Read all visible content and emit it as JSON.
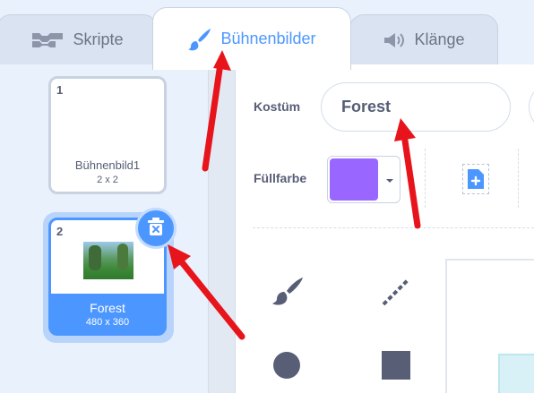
{
  "tabs": {
    "code_label": "Skripte",
    "costumes_label": "Bühnenbilder",
    "sounds_label": "Klänge"
  },
  "backdrops": [
    {
      "number": "1",
      "name": "Bühnenbild1",
      "size": "2 x 2"
    },
    {
      "number": "2",
      "name": "Forest",
      "size": "480 x 360"
    }
  ],
  "editor": {
    "costume_label": "Kostüm",
    "costume_name": "Forest",
    "fill_label": "Füllfarbe",
    "fill_color": "#9966ff"
  },
  "colors": {
    "accent": "#4c97ff",
    "arrow": "#e8141b"
  },
  "icons": {
    "code_tab": "code-blocks-icon",
    "costumes_tab": "paintbrush-icon",
    "sounds_tab": "speaker-icon",
    "delete": "trash-icon",
    "new_costume": "new-costume-icon",
    "brush_tool": "brush-tool-icon",
    "line_tool": "line-tool-icon",
    "circle_tool": "circle-tool-icon",
    "rect_tool": "rectangle-tool-icon"
  }
}
